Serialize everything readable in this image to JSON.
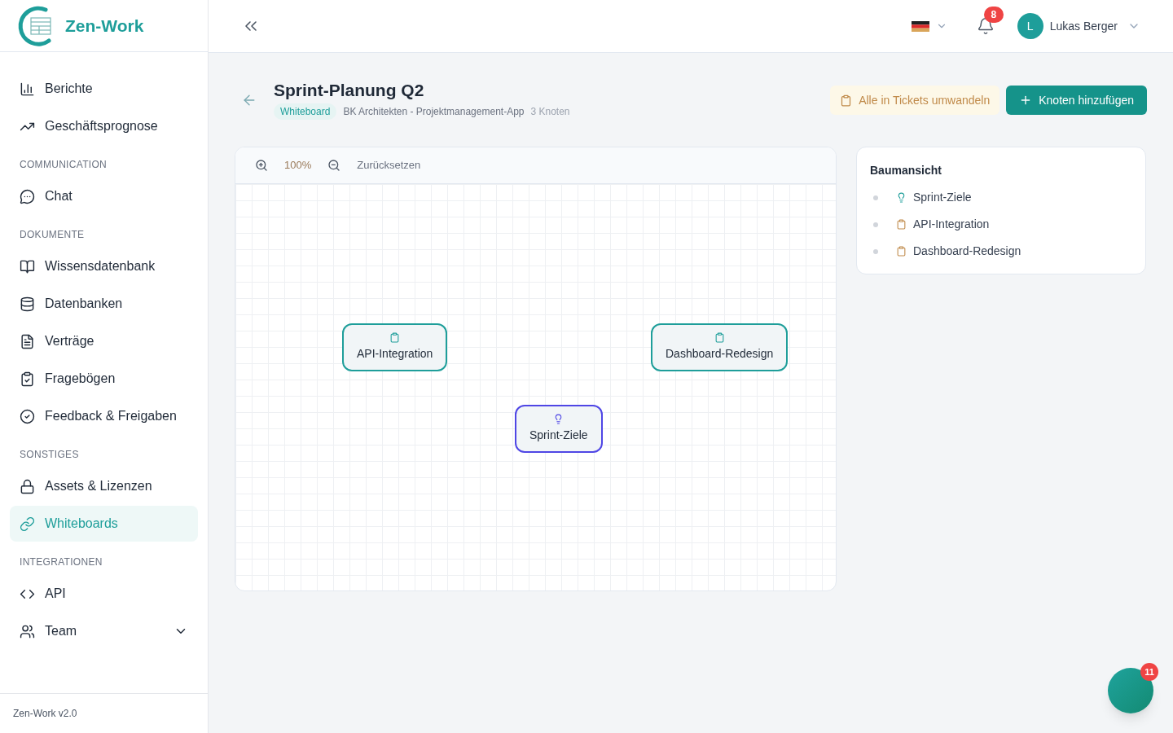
{
  "brand": {
    "name": "Zen-Work"
  },
  "sidebar": {
    "sections": [
      {
        "items": [
          {
            "label": "Berichte",
            "selected": false
          },
          {
            "label": "Geschäftsprognose",
            "selected": false
          }
        ]
      },
      {
        "title": "COMMUNICATION",
        "items": [
          {
            "label": "Chat",
            "selected": false
          }
        ]
      },
      {
        "title": "DOKUMENTE",
        "items": [
          {
            "label": "Wissensdatenbank",
            "selected": false
          },
          {
            "label": "Datenbanken",
            "selected": false
          },
          {
            "label": "Verträge",
            "selected": false
          },
          {
            "label": "Fragebögen",
            "selected": false
          },
          {
            "label": "Feedback & Freigaben",
            "selected": false
          }
        ]
      },
      {
        "title": "SONSTIGES",
        "items": [
          {
            "label": "Assets & Lizenzen",
            "selected": false
          },
          {
            "label": "Whiteboards",
            "selected": true
          }
        ]
      },
      {
        "title": "INTEGRATIONEN",
        "items": [
          {
            "label": "API",
            "selected": false
          },
          {
            "label": "Team",
            "selected": false,
            "expanded": false
          }
        ]
      }
    ],
    "footer": "Zen-Work v2.0"
  },
  "topbar": {
    "notifications": "8",
    "user": {
      "initial": "L",
      "name": "Lukas Berger"
    }
  },
  "page": {
    "title": "Sprint-Planung Q2",
    "badge": "Whiteboard",
    "project": "BK Architekten - Projektmanagement-App",
    "node_count": "3 Knoten",
    "actions": [
      {
        "label": "Alle in Tickets umwandeln",
        "kind": "secondary"
      },
      {
        "label": "Knoten hinzufügen",
        "kind": "primary"
      }
    ]
  },
  "canvas": {
    "zoom": "100%",
    "reset": "Zurücksetzen",
    "nodes": [
      {
        "label": "API-Integration",
        "kind": "task"
      },
      {
        "label": "Dashboard-Redesign",
        "kind": "task"
      },
      {
        "label": "Sprint-Ziele",
        "kind": "goal"
      }
    ]
  },
  "tree": {
    "title": "Baumansicht",
    "items": [
      {
        "label": "Sprint-Ziele",
        "kind": "goal"
      },
      {
        "label": "API-Integration",
        "kind": "task"
      },
      {
        "label": "Dashboard-Redesign",
        "kind": "task"
      }
    ]
  },
  "chat_button": {
    "badge": "11"
  }
}
